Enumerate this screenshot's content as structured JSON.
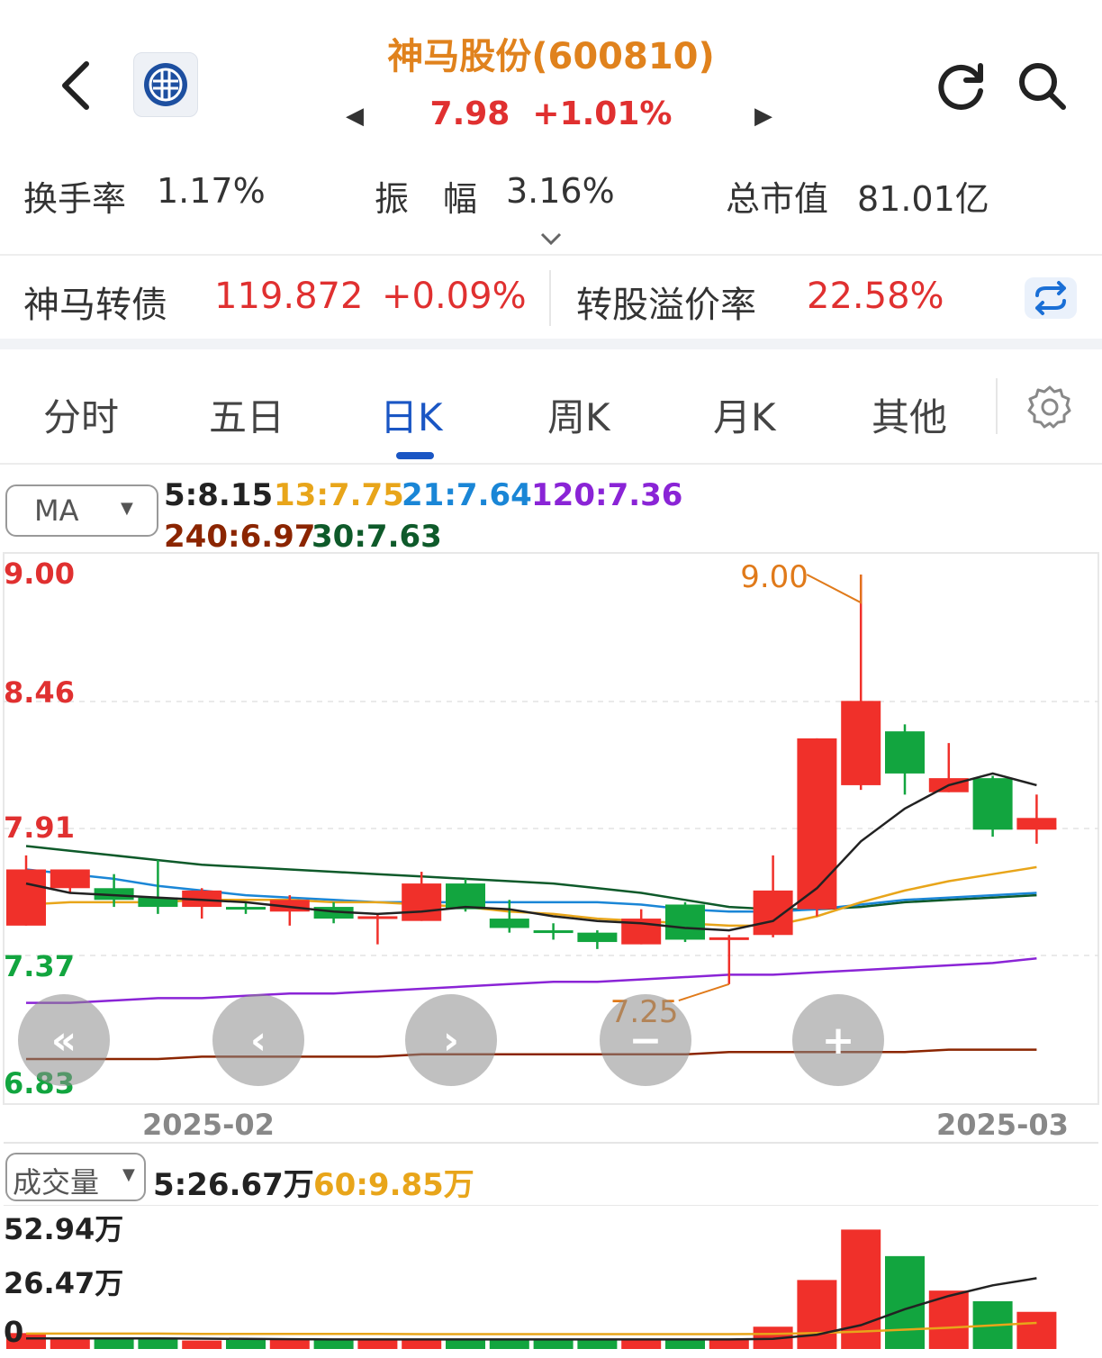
{
  "header": {
    "title": "神马股份(600810)",
    "price": "7.98",
    "change": "+1.01%"
  },
  "stats": {
    "turnover_label": "换手率",
    "turnover_value": "1.17%",
    "amplitude_label": "振　幅",
    "amplitude_value": "3.16%",
    "marketcap_label": "总市值",
    "marketcap_value": "81.01亿"
  },
  "bond": {
    "name": "神马转债",
    "price": "119.872",
    "change": "+0.09%",
    "premium_label": "转股溢价率",
    "premium_value": "22.58%"
  },
  "tabs": [
    {
      "label": "分时"
    },
    {
      "label": "五日"
    },
    {
      "label": "日K"
    },
    {
      "label": "周K"
    },
    {
      "label": "月K"
    },
    {
      "label": "其他"
    }
  ],
  "active_tab": "日K",
  "ma_selector": {
    "label": "MA",
    "arrow": "▼"
  },
  "ma_legend": {
    "ma5": "5:8.15",
    "ma13": "13:7.75",
    "ma21": "21:7.64",
    "ma120": "120:7.36",
    "ma240": "240:6.97",
    "ma30": "30:7.63"
  },
  "colors": {
    "up": "#f0302a",
    "down": "#12a53f",
    "ma5": "#222222",
    "ma13": "#e8a51a",
    "ma21": "#1a86d6",
    "ma120": "#8a24d6",
    "ma240": "#8b2500",
    "ma30": "#0e5a2a",
    "title": "#e0821d",
    "accent": "#1a56c4"
  },
  "y_axis": [
    "9.00",
    "8.46",
    "7.91",
    "7.37",
    "6.83"
  ],
  "x_axis": [
    "2025-02",
    "2025-03"
  ],
  "annotations": {
    "high": "9.00",
    "low": "7.25"
  },
  "nav_buttons": [
    "«",
    "‹",
    "›",
    "−",
    "+"
  ],
  "volume": {
    "selector_label": "成交量",
    "arrow": "▼",
    "ma5": "5:26.67万",
    "ma60": "60:9.85万",
    "y_axis": [
      "52.94万",
      "26.47万",
      "0"
    ]
  },
  "chart_data": {
    "type": "candlestick",
    "ylim": [
      6.83,
      9.0
    ],
    "candles": [
      {
        "o": 7.5,
        "c": 7.74,
        "h": 7.8,
        "l": 7.5
      },
      {
        "o": 7.66,
        "c": 7.74,
        "h": 7.74,
        "l": 7.64
      },
      {
        "o": 7.66,
        "c": 7.61,
        "h": 7.72,
        "l": 7.58
      },
      {
        "o": 7.62,
        "c": 7.58,
        "h": 7.78,
        "l": 7.55
      },
      {
        "o": 7.58,
        "c": 7.65,
        "h": 7.66,
        "l": 7.53
      },
      {
        "o": 7.58,
        "c": 7.57,
        "h": 7.6,
        "l": 7.55
      },
      {
        "o": 7.56,
        "c": 7.61,
        "h": 7.63,
        "l": 7.5
      },
      {
        "o": 7.58,
        "c": 7.53,
        "h": 7.6,
        "l": 7.51
      },
      {
        "o": 7.53,
        "c": 7.54,
        "h": 7.55,
        "l": 7.42
      },
      {
        "o": 7.52,
        "c": 7.68,
        "h": 7.73,
        "l": 7.52
      },
      {
        "o": 7.68,
        "c": 7.57,
        "h": 7.7,
        "l": 7.56
      },
      {
        "o": 7.53,
        "c": 7.49,
        "h": 7.61,
        "l": 7.47
      },
      {
        "o": 7.48,
        "c": 7.47,
        "h": 7.51,
        "l": 7.44
      },
      {
        "o": 7.47,
        "c": 7.43,
        "h": 7.48,
        "l": 7.4
      },
      {
        "o": 7.42,
        "c": 7.53,
        "h": 7.57,
        "l": 7.42
      },
      {
        "o": 7.59,
        "c": 7.44,
        "h": 7.6,
        "l": 7.43
      },
      {
        "o": 7.44,
        "c": 7.45,
        "h": 7.46,
        "l": 7.25
      },
      {
        "o": 7.46,
        "c": 7.65,
        "h": 7.8,
        "l": 7.45
      },
      {
        "o": 7.57,
        "c": 8.3,
        "h": 8.3,
        "l": 7.54
      },
      {
        "o": 8.1,
        "c": 8.46,
        "h": 9.0,
        "l": 8.08
      },
      {
        "o": 8.33,
        "c": 8.15,
        "h": 8.36,
        "l": 8.06
      },
      {
        "o": 8.07,
        "c": 8.13,
        "h": 8.28,
        "l": 8.07
      },
      {
        "o": 8.13,
        "c": 7.91,
        "h": 8.14,
        "l": 7.88
      },
      {
        "o": 7.91,
        "c": 7.96,
        "h": 8.06,
        "l": 7.85
      }
    ],
    "ma5": [
      7.68,
      7.64,
      7.63,
      7.62,
      7.61,
      7.6,
      7.58,
      7.56,
      7.55,
      7.56,
      7.58,
      7.57,
      7.54,
      7.52,
      7.51,
      7.49,
      7.48,
      7.52,
      7.66,
      7.86,
      8.0,
      8.1,
      8.15,
      8.1
    ],
    "ma13": [
      7.59,
      7.6,
      7.6,
      7.6,
      7.61,
      7.61,
      7.61,
      7.6,
      7.6,
      7.59,
      7.58,
      7.56,
      7.55,
      7.53,
      7.52,
      7.51,
      7.5,
      7.5,
      7.54,
      7.6,
      7.65,
      7.69,
      7.72,
      7.75
    ],
    "ma21": [
      7.74,
      7.72,
      7.7,
      7.67,
      7.65,
      7.63,
      7.62,
      7.61,
      7.6,
      7.6,
      7.6,
      7.6,
      7.6,
      7.6,
      7.59,
      7.57,
      7.56,
      7.56,
      7.57,
      7.59,
      7.61,
      7.62,
      7.63,
      7.64
    ],
    "ma30": [
      7.84,
      7.82,
      7.8,
      7.78,
      7.76,
      7.75,
      7.74,
      7.73,
      7.72,
      7.71,
      7.7,
      7.69,
      7.68,
      7.66,
      7.64,
      7.61,
      7.58,
      7.57,
      7.57,
      7.58,
      7.6,
      7.61,
      7.62,
      7.63
    ],
    "ma120": [
      7.17,
      7.17,
      7.18,
      7.19,
      7.19,
      7.2,
      7.21,
      7.21,
      7.22,
      7.23,
      7.24,
      7.25,
      7.26,
      7.26,
      7.27,
      7.28,
      7.29,
      7.29,
      7.3,
      7.31,
      7.32,
      7.33,
      7.34,
      7.36
    ],
    "ma240": [
      6.93,
      6.93,
      6.93,
      6.93,
      6.94,
      6.94,
      6.94,
      6.94,
      6.94,
      6.95,
      6.95,
      6.95,
      6.95,
      6.95,
      6.95,
      6.95,
      6.96,
      6.96,
      6.96,
      6.96,
      6.96,
      6.97,
      6.97,
      6.97
    ],
    "volumes": [
      6.0,
      4.4,
      4.0,
      3.6,
      3.2,
      3.4,
      3.8,
      3.6,
      3.4,
      3.6,
      3.8,
      3.6,
      3.5,
      3.6,
      3.4,
      3.8,
      3.6,
      8.4,
      26.0,
      45.0,
      35.0,
      22.0,
      18.0,
      14.0
    ],
    "vol_ylim": [
      0,
      52.94
    ],
    "vol_ma5": [
      4.0,
      4.0,
      4.0,
      4.0,
      3.9,
      3.8,
      3.7,
      3.6,
      3.6,
      3.6,
      3.6,
      3.6,
      3.6,
      3.6,
      3.6,
      3.6,
      3.6,
      3.8,
      5.4,
      9.0,
      15.0,
      20.0,
      24.0,
      26.67
    ],
    "vol_ma60": [
      5.8,
      5.8,
      5.8,
      5.8,
      5.7,
      5.7,
      5.7,
      5.7,
      5.7,
      5.6,
      5.6,
      5.6,
      5.6,
      5.6,
      5.6,
      5.6,
      5.6,
      5.7,
      6.0,
      6.6,
      7.3,
      8.0,
      8.9,
      9.85
    ]
  }
}
